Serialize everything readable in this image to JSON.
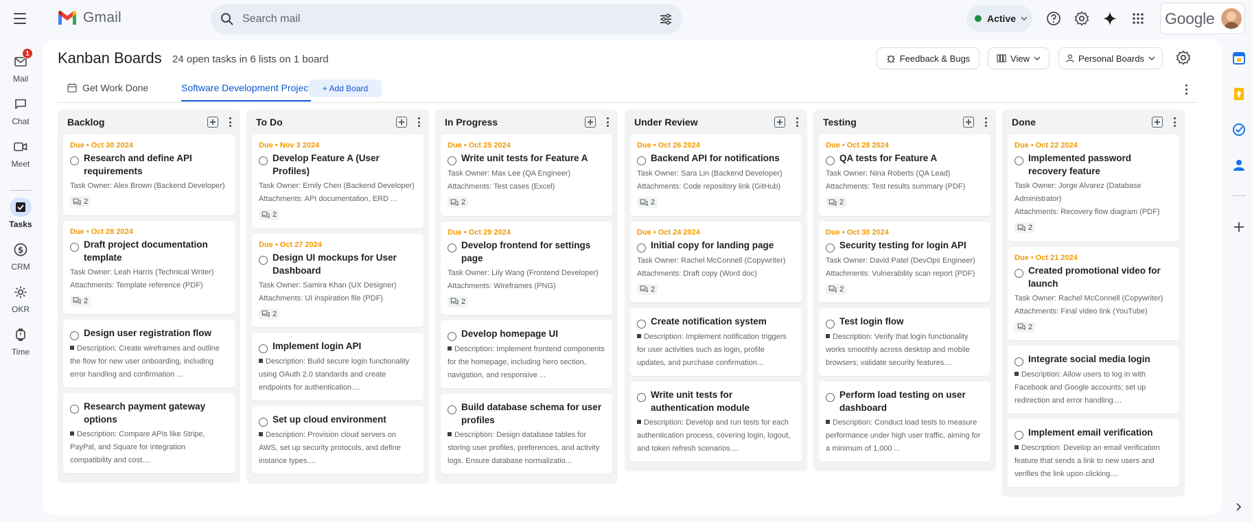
{
  "app": {
    "name": "Gmail"
  },
  "search": {
    "placeholder": "Search mail"
  },
  "status": {
    "label": "Active",
    "color": "#1e8e3e"
  },
  "account": {
    "brand": "Google"
  },
  "nav": [
    {
      "label": "Mail",
      "icon": "mail-icon",
      "badge": "1"
    },
    {
      "label": "Chat",
      "icon": "chat-icon"
    },
    {
      "label": "Meet",
      "icon": "meet-icon"
    },
    {
      "label": "Tasks",
      "icon": "tasks-icon",
      "active": true
    },
    {
      "label": "CRM",
      "icon": "crm-icon"
    },
    {
      "label": "OKR",
      "icon": "okr-icon"
    },
    {
      "label": "Time",
      "icon": "time-icon"
    }
  ],
  "page": {
    "title": "Kanban Boards",
    "subtitle": "24 open tasks in 6 lists on 1 board",
    "feedback_label": "Feedback & Bugs",
    "view_label": "View",
    "boards_label": "Personal Boards"
  },
  "tabs": [
    {
      "label": "Get Work Done"
    },
    {
      "label": "Software Development Project",
      "active": true
    }
  ],
  "add_board_label": "+ Add Board",
  "columns": [
    {
      "title": "Backlog",
      "cards": [
        {
          "due": "Due • Oct 30 2024",
          "title": "Research and define API requirements",
          "meta": [
            "Task Owner: Alex Brown (Backend Developer)"
          ],
          "comments": "2"
        },
        {
          "due": "Due • Oct 28 2024",
          "title": "Draft project documentation template",
          "meta": [
            "Task Owner: Leah Harris (Technical Writer)",
            "Attachments: Template reference (PDF)"
          ],
          "comments": "2"
        },
        {
          "title": "Design user registration flow",
          "desc": "Description: Create wireframes and outline the flow for new user onboarding, including error handling and confirmation ..."
        },
        {
          "title": "Research payment gateway options",
          "desc": "Description: Compare APIs like Stripe, PayPal, and Square for integration compatibility and cost...."
        }
      ]
    },
    {
      "title": "To Do",
      "cards": [
        {
          "due": "Due • Nov 3 2024",
          "title": "Develop Feature A (User Profiles)",
          "meta": [
            "Task Owner: Emily Chen (Backend Developer)",
            "Attachments: API documentation, ERD ..."
          ],
          "comments": "2"
        },
        {
          "due": "Due • Oct 27 2024",
          "title": "Design UI mockups for User Dashboard",
          "meta": [
            "Task Owner: Samira Khan (UX Designer)",
            "Attachments: UI inspiration file (PDF)"
          ],
          "comments": "2"
        },
        {
          "title": "Implement login API",
          "desc": "Description: Build secure login functionality using OAuth 2.0 standards and create endpoints for authentication...."
        },
        {
          "title": "Set up cloud environment",
          "desc": "Description: Provision cloud servers on AWS, set up security protocols, and define instance types...."
        }
      ]
    },
    {
      "title": "In Progress",
      "cards": [
        {
          "due": "Due • Oct 25 2024",
          "title": "Write unit tests for Feature A",
          "meta": [
            "Task Owner: Max Lee (QA Engineer)",
            "Attachments: Test cases (Excel)"
          ],
          "comments": "2"
        },
        {
          "due": "Due • Oct 29 2024",
          "title": "Develop frontend for settings page",
          "meta": [
            "Task Owner: Lily Wang (Frontend Developer)",
            "Attachments: Wireframes (PNG)"
          ],
          "comments": "2"
        },
        {
          "title": "Develop homepage UI",
          "desc": "Description: Implement frontend components for the homepage, including hero section, navigation, and responsive ..."
        },
        {
          "title": "Build database schema for user profiles",
          "desc": "Description: Design database tables for storing user profiles, preferences, and activity logs. Ensure database normalizatio..."
        }
      ]
    },
    {
      "title": "Under Review",
      "cards": [
        {
          "due": "Due • Oct 26 2024",
          "title": "Backend API for notifications",
          "meta": [
            "Task Owner: Sara Lin (Backend Developer)",
            "Attachments: Code repository link (GitHub)"
          ],
          "comments": "2"
        },
        {
          "due": "Due • Oct 24 2024",
          "title": "Initial copy for landing page",
          "meta": [
            "Task Owner: Rachel McConnell (Copywriter)",
            "Attachments: Draft copy (Word doc)"
          ],
          "comments": "2"
        },
        {
          "title": "Create notification system",
          "desc": "Description: Implement notification triggers for user activities such as login, profile updates, and purchase confirmation..."
        },
        {
          "title": "Write unit tests for authentication module",
          "desc": "Description: Develop and run tests for each authentication process, covering login, logout, and token refresh scenarios...."
        }
      ]
    },
    {
      "title": "Testing",
      "cards": [
        {
          "due": "Due • Oct 28 2024",
          "title": "QA tests for Feature A",
          "meta": [
            "Task Owner: Nina Roberts (QA Lead)",
            "Attachments: Test results summary (PDF)"
          ],
          "comments": "2"
        },
        {
          "due": "Due • Oct 30 2024",
          "title": "Security testing for login API",
          "meta": [
            "Task Owner: David Patel (DevOps Engineer)",
            "Attachments: Vulnerability scan report (PDF)"
          ],
          "comments": "2"
        },
        {
          "title": "Test login flow",
          "desc": "Description: Verify that login functionality works smoothly across desktop and mobile browsers; validate security features...."
        },
        {
          "title": "Perform load testing on user dashboard",
          "desc": "Description: Conduct load tests to measure performance under high user traffic, aiming for a minimum of 1,000 ..."
        }
      ]
    },
    {
      "title": "Done",
      "cards": [
        {
          "due": "Due • Oct 22 2024",
          "title": "Implemented password recovery feature",
          "meta": [
            "Task Owner: Jorge Alvarez (Database Administrator)",
            "Attachments: Recovery flow diagram (PDF)"
          ],
          "comments": "2"
        },
        {
          "due": "Due • Oct 21 2024",
          "title": "Created promotional video for launch",
          "meta": [
            "Task Owner: Rachel McConnell (Copywriter)",
            "Attachments: Final video link (YouTube)"
          ],
          "comments": "2"
        },
        {
          "title": "Integrate social media login",
          "desc": "Description: Allow users to log in with Facebook and Google accounts; set up redirection and error handling...."
        },
        {
          "title": "Implement email verification",
          "desc": "Description: Develop an email verification feature that sends a link to new users and verifies the link upon clicking...."
        }
      ]
    }
  ],
  "colors": {
    "accent": "#0b57d0",
    "due": "#f29900",
    "badge": "#d93025"
  }
}
